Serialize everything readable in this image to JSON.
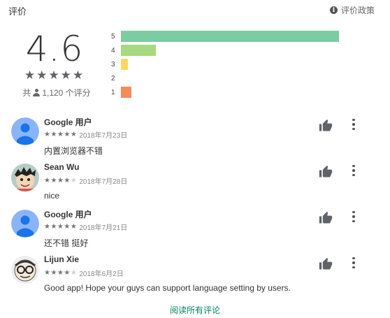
{
  "section_title": "评价",
  "policy_label": "评价政策",
  "summary": {
    "score": "4.6",
    "stars": "★★★★★",
    "count_prefix": "共",
    "count_text": "1,120 个评分"
  },
  "histogram": [
    {
      "label": "5",
      "fraction": 1.0,
      "color": "#7ccba2"
    },
    {
      "label": "4",
      "fraction": 0.16,
      "color": "#a8d87f"
    },
    {
      "label": "3",
      "fraction": 0.032,
      "color": "#fdd663"
    },
    {
      "label": "2",
      "fraction": 0.0,
      "color": "#ffb178"
    },
    {
      "label": "1",
      "fraction": 0.048,
      "color": "#f58b5a"
    }
  ],
  "reviews": [
    {
      "author": "Google 用户",
      "stars_filled": "★★★★★",
      "stars_empty": "",
      "rating": 5,
      "date": "2018年7月23日",
      "text": "内置浏览器不错",
      "avatar": "default-user"
    },
    {
      "author": "Sean Wu",
      "stars_filled": "★★★★",
      "stars_empty": "★",
      "rating": 4,
      "date": "2018年7月28日",
      "text": "nice",
      "avatar": "cartoon-character"
    },
    {
      "author": "Google 用户",
      "stars_filled": "★★★★★",
      "stars_empty": "",
      "rating": 5,
      "date": "2018年7月21日",
      "text": "还不错 挺好",
      "avatar": "default-user"
    },
    {
      "author": "Lijun Xie",
      "stars_filled": "★★★★",
      "stars_empty": "★",
      "rating": 4,
      "date": "2018年6月2日",
      "text": "Good app! Hope your guys can support language setting by users.",
      "avatar": "glasses-face"
    }
  ],
  "read_all_label": "阅读所有评论",
  "colors": {
    "accent_green": "#01875f",
    "star_gray": "#757575",
    "empty_star": "#d0d0d0"
  },
  "icons": {
    "info": "info-icon",
    "person": "person-icon",
    "thumb": "thumb-up-icon",
    "more": "more-vert-icon"
  }
}
